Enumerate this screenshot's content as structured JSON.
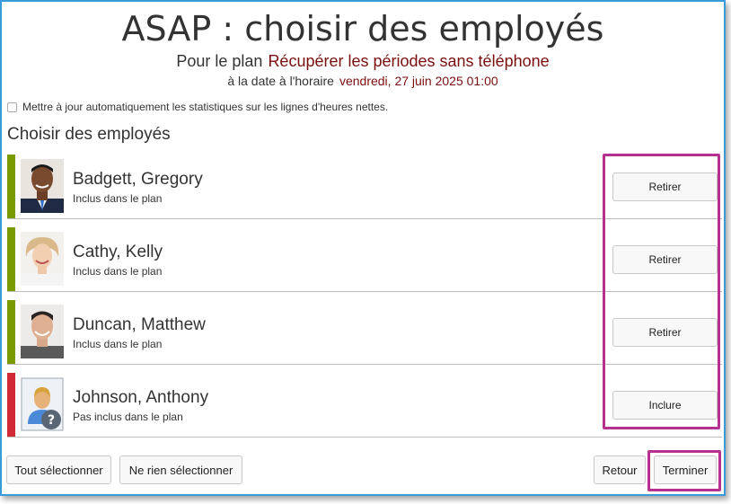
{
  "header": {
    "title": "ASAP : choisir des employés",
    "plan_prefix": "Pour le plan",
    "plan_name": "Récupérer les périodes sans téléphone",
    "date_prefix": "à la date à l'horaire",
    "date_value": "vendredi, 27 juin 2025 01:00"
  },
  "auto_update": {
    "label": "Mettre à jour automatiquement les statistiques sur les lignes d'heures nettes.",
    "checked": false
  },
  "section_title": "Choisir des employés",
  "employees": [
    {
      "name": "Badgett, Gregory",
      "status": "Inclus dans le plan",
      "action": "Retirer",
      "status_color": "#7a9a01"
    },
    {
      "name": "Cathy, Kelly",
      "status": "Inclus dans le plan",
      "action": "Retirer",
      "status_color": "#7a9a01"
    },
    {
      "name": "Duncan, Matthew",
      "status": "Inclus dans le plan",
      "action": "Retirer",
      "status_color": "#7a9a01"
    },
    {
      "name": "Johnson, Anthony",
      "status": "Pas inclus dans le plan",
      "action": "Inclure",
      "status_color": "#d02b35"
    }
  ],
  "footer": {
    "select_all": "Tout sélectionner",
    "select_none": "Ne rien sélectionner",
    "back": "Retour",
    "finish": "Terminer"
  },
  "colors": {
    "highlight": "#b5308f",
    "plan_text": "#7a0f0f",
    "frame_border": "#3a9ad9"
  }
}
